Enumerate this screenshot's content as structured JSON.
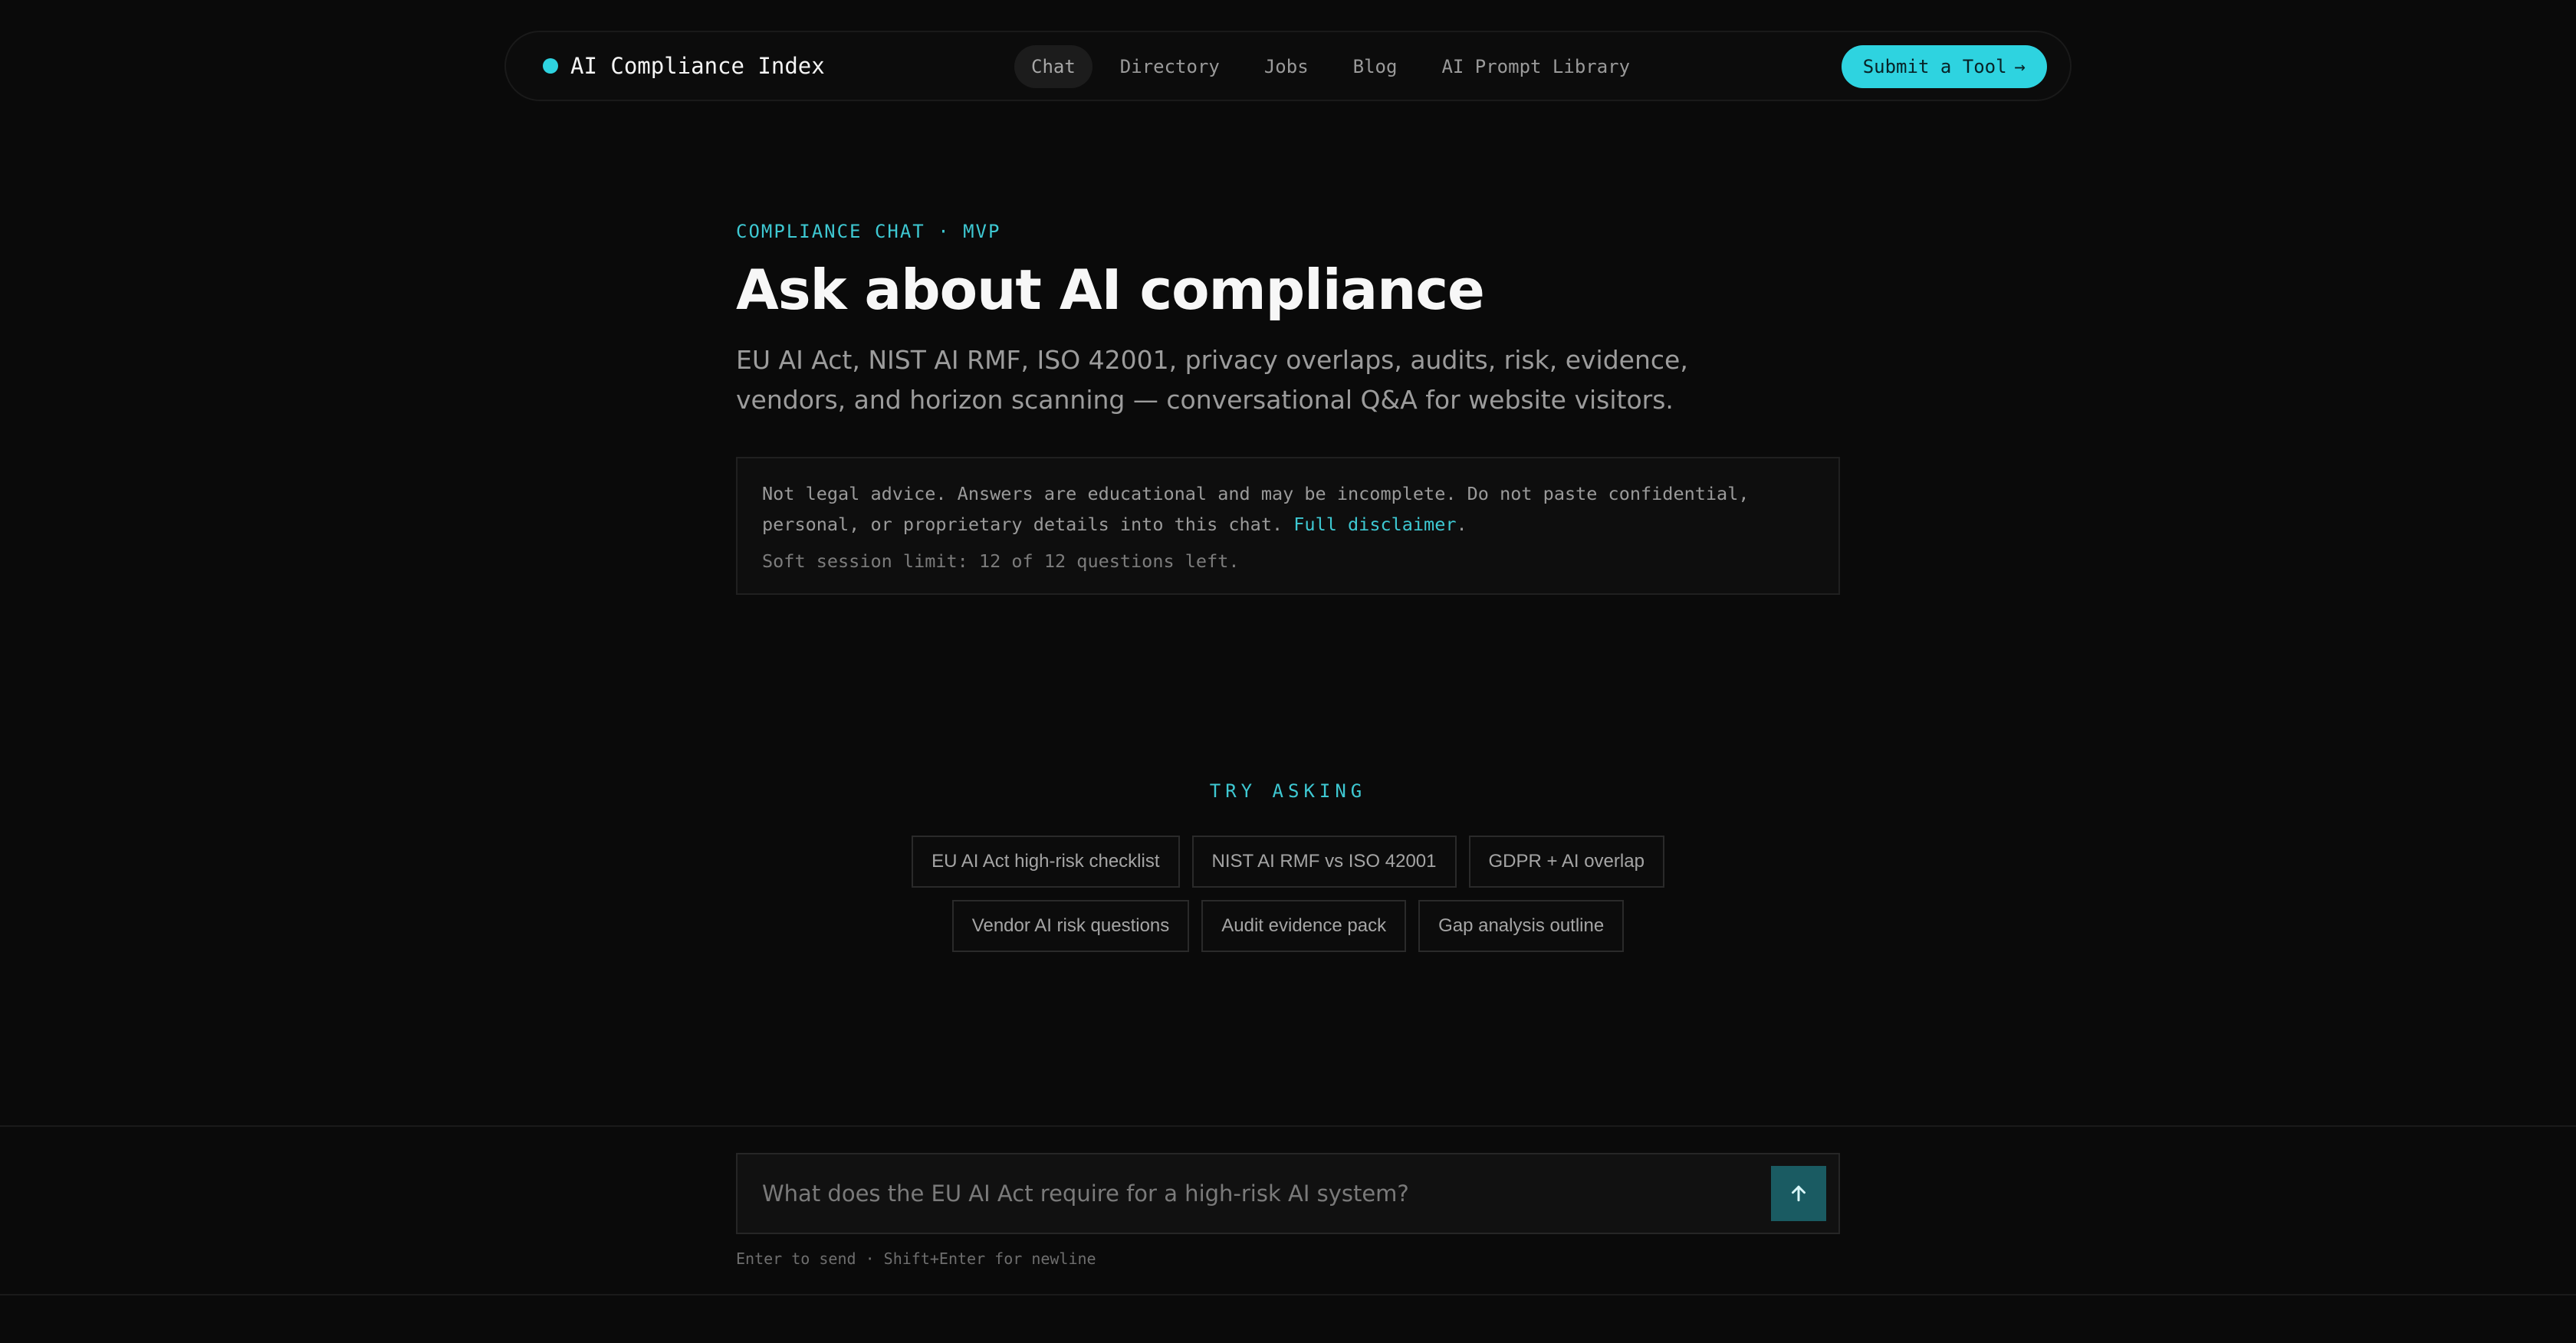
{
  "nav": {
    "brand": "AI Compliance Index",
    "links": [
      "Chat",
      "Directory",
      "Jobs",
      "Blog",
      "AI Prompt Library"
    ],
    "cta": "Submit a Tool",
    "cta_arrow": "→"
  },
  "hero": {
    "eyebrow": "COMPLIANCE CHAT · MVP",
    "title": "Ask about AI compliance",
    "subtitle": "EU AI Act, NIST AI RMF, ISO 42001, privacy overlaps, audits, risk, evidence, vendors, and horizon scanning — conversational Q&A for website visitors."
  },
  "notice": {
    "text": "Not legal advice. Answers are educational and may be incomplete. Do not paste confidential, personal, or proprietary details into this chat.",
    "link": "Full disclaimer",
    "link_suffix": ".",
    "limit": "Soft session limit: 12 of 12 questions left."
  },
  "suggestions": {
    "heading": "TRY ASKING",
    "row1": [
      "EU AI Act high-risk checklist",
      "NIST AI RMF vs ISO 42001",
      "GDPR + AI overlap"
    ],
    "row2": [
      "Vendor AI risk questions",
      "Audit evidence pack",
      "Gap analysis outline"
    ]
  },
  "composer": {
    "placeholder": "What does the EU AI Act require for a high-risk AI system?",
    "value": "",
    "send_icon": "arrow-up-icon",
    "hint": "Enter to send · Shift+Enter for newline"
  },
  "colors": {
    "accent": "#2ed3e0",
    "background": "#0a0a0a",
    "send_button": "#1a5b62"
  }
}
